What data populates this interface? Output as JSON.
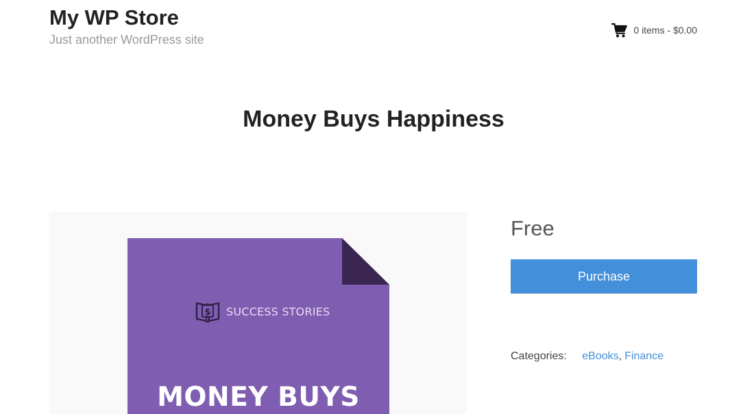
{
  "header": {
    "site_title": "My WP Store",
    "tagline": "Just another WordPress site",
    "cart": {
      "icon": "cart-icon",
      "text": "0 items - $0.00"
    }
  },
  "product": {
    "title": "Money Buys Happiness",
    "price": "Free",
    "purchase_label": "Purchase",
    "categories_label": "Categories:",
    "categories": [
      "eBooks",
      "Finance"
    ],
    "image": {
      "brand_icon": "book-dollar-icon",
      "brand_text": "SUCCESS STORIES",
      "cover_title": "MONEY BUYS"
    }
  },
  "colors": {
    "accent": "#448fd9",
    "cover": "#7f5db0",
    "cover_fold": "#3a2650",
    "tagline": "#9a9a9a"
  }
}
